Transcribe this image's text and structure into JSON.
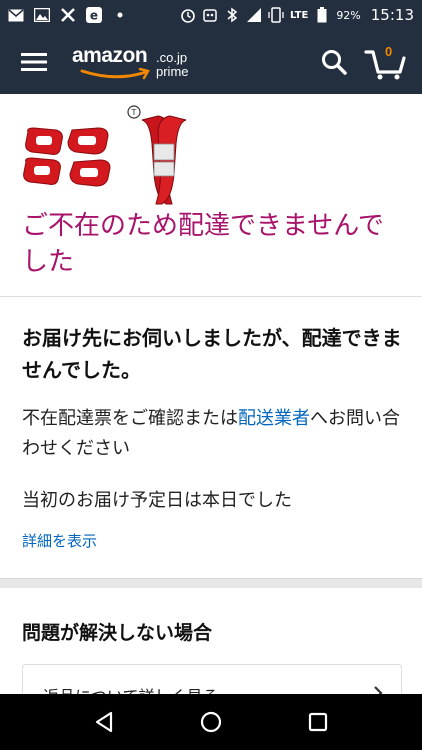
{
  "status_bar": {
    "time": "15:13",
    "battery": "92%",
    "network": "LTE",
    "icons": [
      "mail-icon",
      "image-icon",
      "x-app-icon",
      "edge-icon",
      "alarm-icon",
      "robot-icon",
      "bluetooth-icon",
      "signal-icon",
      "vibrate-icon",
      "battery-icon"
    ]
  },
  "header": {
    "logo_text": "amazon",
    "logo_tld": ".co.jp",
    "logo_sub": "prime",
    "cart_count": "0"
  },
  "main": {
    "headline": "ご不在のため配達できませんでした",
    "info_title": "お届け先にお伺いしましたが、配達できませんでした。",
    "info_body_pre": "不在配達票をご確認または",
    "info_body_link": "配送業者",
    "info_body_post": "へお問い合わせください",
    "expected": "当初のお届け予定日は本日でした",
    "details_link": "詳細を表示"
  },
  "problem": {
    "title": "問題が解決しない場合",
    "option_label": "返品について詳しく見る"
  },
  "colors": {
    "header_bg": "#232f3e",
    "headline": "#a8136b",
    "link": "#0066c0",
    "cart_accent": "#f08804"
  }
}
